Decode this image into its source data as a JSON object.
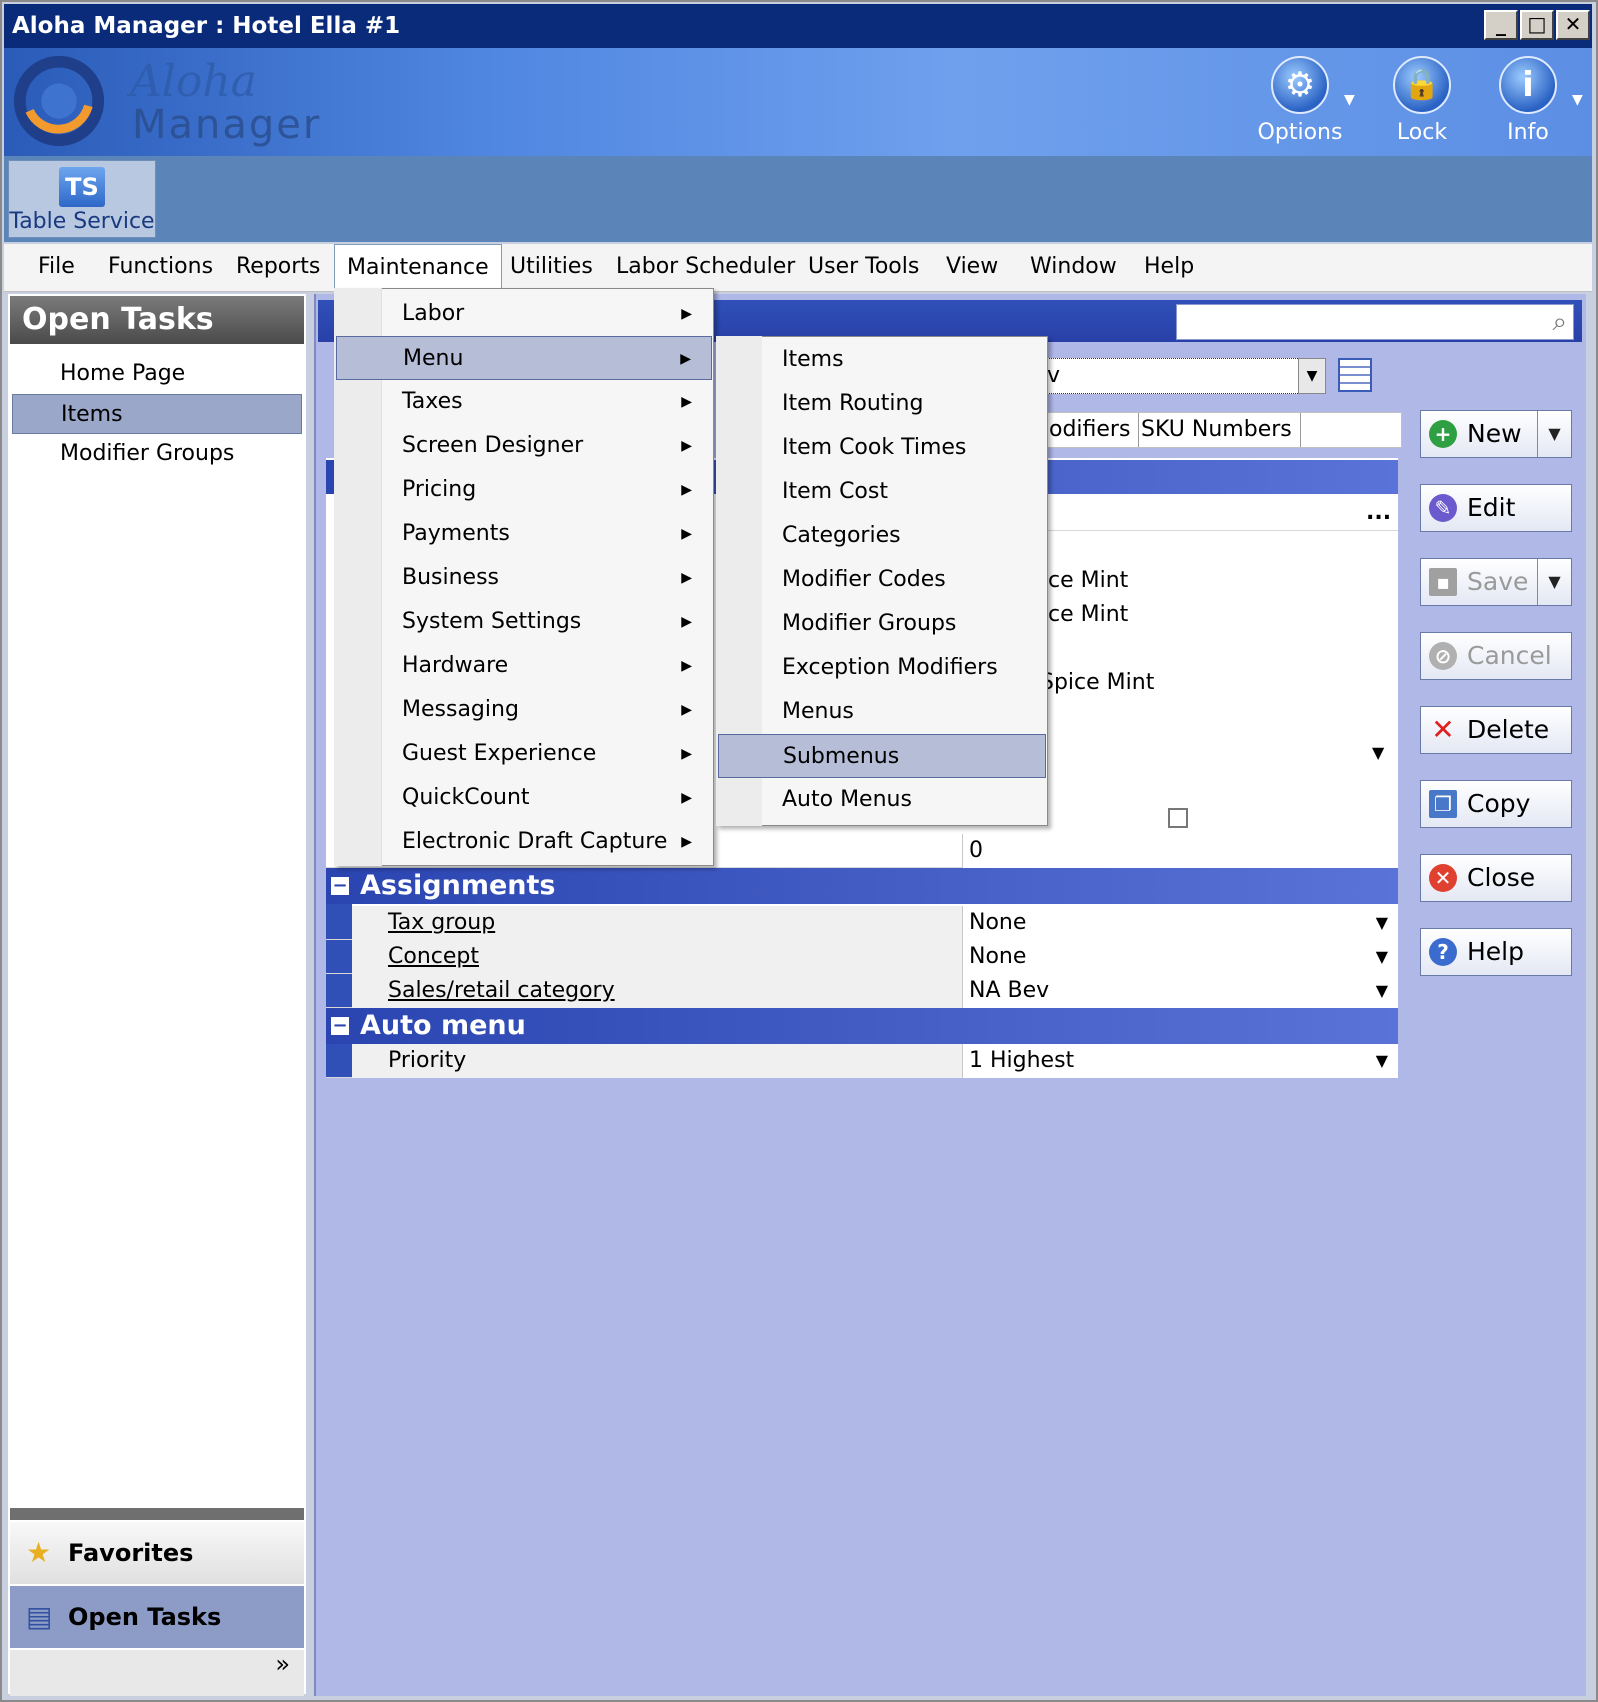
{
  "window": {
    "title": "Aloha Manager : Hotel Ella #1",
    "controls": [
      "_",
      "□",
      "✕"
    ]
  },
  "banner": {
    "logo_script": "Aloha",
    "logo_word": "Manager",
    "buttons": [
      {
        "label": "Options",
        "icon": "gear-icon"
      },
      {
        "label": "Lock",
        "icon": "lock-icon"
      },
      {
        "label": "Info",
        "icon": "info-icon"
      }
    ]
  },
  "module": {
    "badge": "TS",
    "label": "Table Service"
  },
  "menubar": [
    "File",
    "Functions",
    "Reports",
    "Maintenance",
    "Utilities",
    "Labor Scheduler",
    "User Tools",
    "View",
    "Window",
    "Help"
  ],
  "left_panel": {
    "title": "Open Tasks",
    "items": [
      "Home Page",
      "Items",
      "Modifier Groups"
    ],
    "selected": "Items",
    "nav": {
      "favorites": "Favorites",
      "open_tasks": "Open Tasks",
      "more": "»"
    }
  },
  "main": {
    "filter_value": "v",
    "tabs": [
      "odifiers",
      "SKU Numbers"
    ],
    "partial_values": [
      "ce Mint",
      "ce Mint",
      "Spice Mint"
    ],
    "zero_value": "0",
    "sections": {
      "assignments": "Assignments",
      "auto_menu": "Auto menu"
    },
    "assignments_rows": [
      {
        "label": "Tax group",
        "value": "None"
      },
      {
        "label": "Concept",
        "value": "None"
      },
      {
        "label": "Sales/retail category",
        "value": "NA Bev"
      }
    ],
    "auto_menu_rows": [
      {
        "label": "Priority",
        "value": "1 Highest"
      }
    ],
    "ellipsis": "..."
  },
  "actions": {
    "new": "New",
    "edit": "Edit",
    "save": "Save",
    "cancel": "Cancel",
    "delete": "Delete",
    "copy": "Copy",
    "close": "Close",
    "help": "Help"
  },
  "maintenance_menu": [
    "Labor",
    "Menu",
    "Taxes",
    "Screen Designer",
    "Pricing",
    "Payments",
    "Business",
    "System Settings",
    "Hardware",
    "Messaging",
    "Guest Experience",
    "QuickCount",
    "Electronic Draft Capture"
  ],
  "menu_submenu": [
    "Items",
    "Item Routing",
    "Item Cook Times",
    "Item Cost",
    "Categories",
    "Modifier Codes",
    "Modifier Groups",
    "Exception Modifiers",
    "Menus",
    "Submenus",
    "Auto Menus"
  ],
  "colors": {
    "titlebar": "#0a2a7a",
    "section": "#2a45b0",
    "highlight": "#b6bdd7",
    "panel": "#b0b8e8"
  }
}
